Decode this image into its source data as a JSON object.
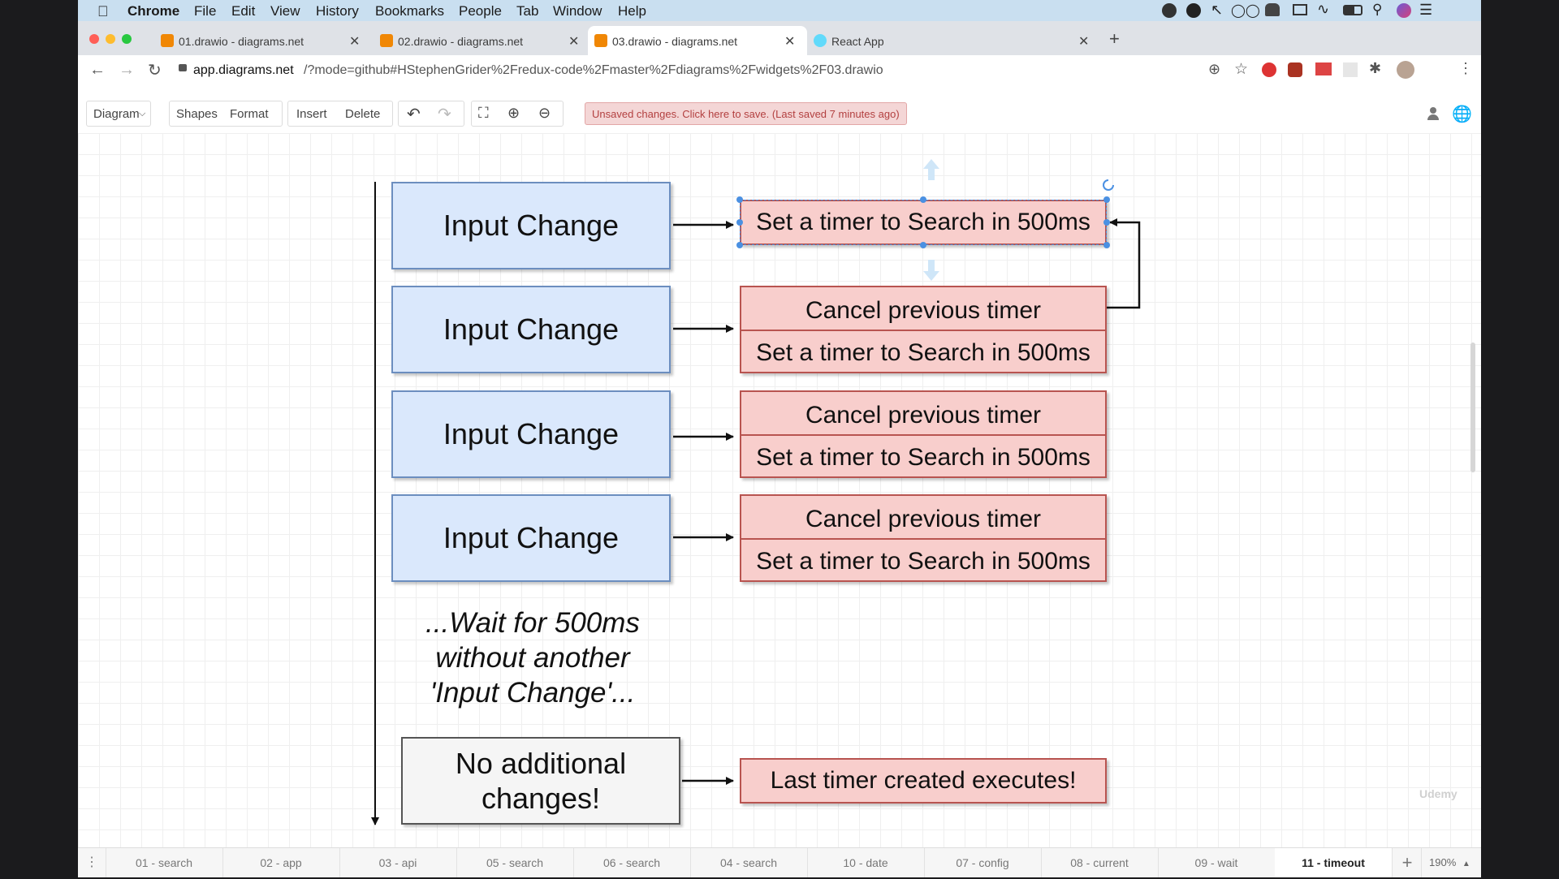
{
  "menubar": {
    "app": "Chrome",
    "items": [
      "File",
      "Edit",
      "View",
      "History",
      "Bookmarks",
      "People",
      "Tab",
      "Window",
      "Help"
    ]
  },
  "tabs": [
    {
      "label": "01.drawio - diagrams.net",
      "icon": "drawio-icon"
    },
    {
      "label": "02.drawio - diagrams.net",
      "icon": "drawio-icon"
    },
    {
      "label": "03.drawio - diagrams.net",
      "icon": "drawio-icon"
    },
    {
      "label": "React App",
      "icon": "react-icon"
    }
  ],
  "address": {
    "host": "app.diagrams.net",
    "path": "/?mode=github#HStephenGrider%2Fredux-code%2Fmaster%2Fdiagrams%2Fwidgets%2F03.drawio"
  },
  "toolbar": {
    "diagram": "Diagram",
    "shapes": "Shapes",
    "format": "Format",
    "insert": "Insert",
    "delete": "Delete",
    "status": "Unsaved changes. Click here to save. (Last saved 7 minutes ago)"
  },
  "diagram": {
    "input_change": "Input Change",
    "set_timer_selected": "Set a timer to Search in 500ms",
    "groups": [
      {
        "top": "Cancel previous timer",
        "bottom": "Set a timer to Search in 500ms"
      },
      {
        "top": "Cancel previous timer",
        "bottom": "Set a timer to Search in 500ms"
      },
      {
        "top": "Cancel previous timer",
        "bottom": "Set a timer to Search in 500ms"
      }
    ],
    "wait_line1": "...Wait for 500ms",
    "wait_line2": "without another",
    "wait_line3": "'Input Change'...",
    "no_changes_line1": "No additional",
    "no_changes_line2": "changes!",
    "last_timer": "Last timer created executes!"
  },
  "watermark": "Udemy",
  "pages": [
    "01 - search",
    "02 - app",
    "03 - api",
    "05 - search",
    "06 - search",
    "04 - search",
    "10 - date",
    "07 - config",
    "08 - current",
    "09 - wait",
    "11 - timeout"
  ],
  "zoom": "190%"
}
